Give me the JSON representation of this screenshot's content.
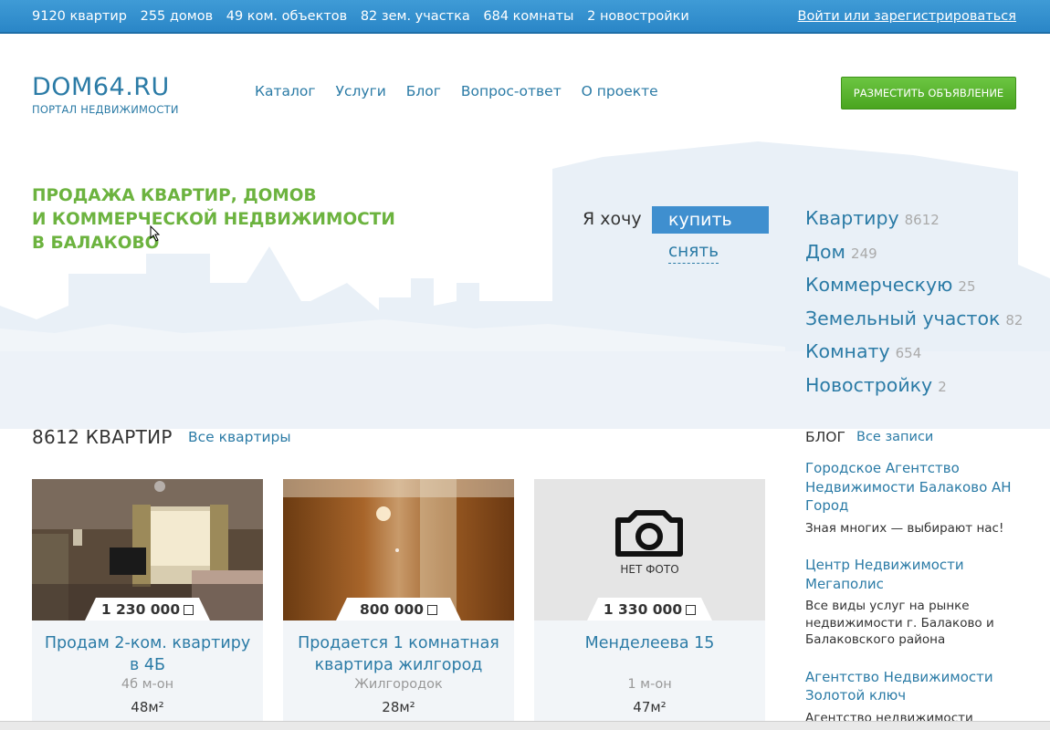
{
  "topbar": {
    "stats": [
      "9120 квартир",
      "255 домов",
      "49 ком. объектов",
      "82 зем. участка",
      "684 комнаты",
      "2 новостройки"
    ],
    "login": "Войти или зарегистрироваться",
    "bg_color": "#3a95d3"
  },
  "logo": {
    "name": "DOM64.RU",
    "subtitle": "ПОРТАЛ НЕДВИЖИМОСТИ"
  },
  "nav": [
    "Каталог",
    "Услуги",
    "Блог",
    "Вопрос-ответ",
    "О проекте"
  ],
  "post_button": "РАЗМЕСТИТЬ ОБЪЯВЛЕНИЕ",
  "hero": {
    "title_lines": [
      "ПРОДАЖА КВАРТИР, ДОМОВ",
      "И КОММЕРЧЕСКОЙ НЕДВИЖИМОСТИ",
      "В БАЛАКОВО"
    ],
    "accent_color": "#6cb33f"
  },
  "want": {
    "label": "Я хочу",
    "buy": "купить",
    "rent": "снять"
  },
  "categories": [
    {
      "label": "Квартиру",
      "count": "8612"
    },
    {
      "label": "Дом",
      "count": "249"
    },
    {
      "label": "Коммерческую",
      "count": "25"
    },
    {
      "label": "Земельный участок",
      "count": "82"
    },
    {
      "label": "Комнату",
      "count": "654"
    },
    {
      "label": "Новостройку",
      "count": "2"
    }
  ],
  "section": {
    "title": "8612 КВАРТИР",
    "all_link": "Все квартиры"
  },
  "listings": [
    {
      "price": "1 230 000",
      "title": "Продам 2-ком. квартиру в 4Б",
      "district": "4б м-он",
      "area": "48м²",
      "photo": "room-photo"
    },
    {
      "price": "800 000",
      "title": "Продается 1 комнатная квартира жилгород",
      "district": "Жилгородок",
      "area": "28м²",
      "photo": "curtain-photo"
    },
    {
      "price": "1 330 000",
      "title": "Менделеева 15",
      "district": "1 м-он",
      "area": "47м²",
      "photo": "no-photo",
      "no_photo_label": "НЕТ ФОТО"
    }
  ],
  "blog": {
    "heading": "БЛОГ",
    "all_link": "Все записи",
    "posts": [
      {
        "title": "Городское Агентство Недвижимости Балаково АН Город",
        "text": "Зная многих — выбирают нас!"
      },
      {
        "title": "Центр Недвижимости Мегаполис",
        "text": "Все виды услуг на рынке недвижимости г. Балаково и Балаковского района"
      },
      {
        "title": "Агентство Недвижимости Золотой ключ",
        "text": "Агентство недвижимости"
      }
    ]
  }
}
